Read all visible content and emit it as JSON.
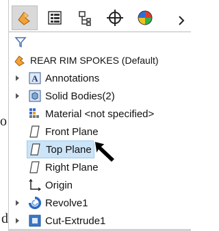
{
  "background_text": {
    "o_fragment": "o",
    "d_fragment": "d"
  },
  "toolbar": {
    "tabs": [
      {
        "name": "feature-manager-tab-icon"
      },
      {
        "name": "property-manager-tab-icon"
      },
      {
        "name": "configuration-manager-tab-icon"
      },
      {
        "name": "dimxpert-manager-tab-icon"
      },
      {
        "name": "display-manager-tab-icon"
      }
    ],
    "more_icon": "chevron-right-icon"
  },
  "filter_icon": "filter-icon",
  "tree": {
    "root": {
      "label": "REAR RIM SPOKES (Default)"
    },
    "items": [
      {
        "label": "Annotations",
        "expandable": true
      },
      {
        "label": "Solid Bodies(2)",
        "expandable": true
      },
      {
        "label": "Material <not specified>",
        "expandable": false
      },
      {
        "label": "Front Plane",
        "expandable": false
      },
      {
        "label": "Top Plane",
        "expandable": false,
        "selected": true
      },
      {
        "label": "Right Plane",
        "expandable": false
      },
      {
        "label": "Origin",
        "expandable": false
      },
      {
        "label": "Revolve1",
        "expandable": true
      },
      {
        "label": "Cut-Extrude1",
        "expandable": true
      }
    ]
  },
  "colors": {
    "selection_bg": "#cce4f7",
    "selection_border": "#99c9ef",
    "part_icon": "#f2a23a"
  }
}
